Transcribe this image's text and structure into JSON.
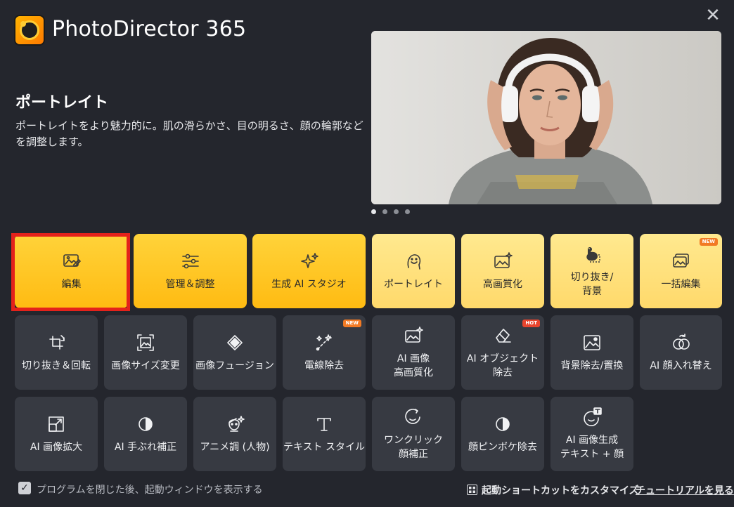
{
  "app": {
    "title": "PhotoDirector 365"
  },
  "feature": {
    "title": "ポートレイト",
    "description": "ポートレイトをより魅力的に。肌の滑らかさ、目の明るさ、顔の輪郭などを調整します。"
  },
  "carousel": {
    "count": 4,
    "active": 0
  },
  "row1": [
    {
      "label": "編集",
      "icon": "photo-edit-icon",
      "selected": true
    },
    {
      "label": "管理＆調整",
      "icon": "sliders-icon"
    },
    {
      "label": "生成 AI スタジオ",
      "icon": "sparkles-icon"
    },
    {
      "label": "ポートレイト",
      "icon": "face-icon"
    },
    {
      "label": "高画質化",
      "icon": "image-sparkle-icon"
    },
    {
      "label": "切り抜き/\n背景",
      "icon": "cutout-duck-icon"
    },
    {
      "label": "一括編集",
      "icon": "batch-images-icon",
      "badge": "NEW"
    }
  ],
  "row2": [
    {
      "label": "切り抜き＆回転",
      "icon": "crop-rotate-icon"
    },
    {
      "label": "画像サイズ変更",
      "icon": "resize-icon"
    },
    {
      "label": "画像フュージョン",
      "icon": "fusion-icon"
    },
    {
      "label": "電線除去",
      "icon": "wire-remove-icon",
      "badge": "NEW"
    },
    {
      "label": "AI 画像\n高画質化",
      "icon": "image-sparkle-icon"
    },
    {
      "label": "AI オブジェクト\n除去",
      "icon": "eraser-icon",
      "badge": "HOT"
    },
    {
      "label": "背景除去/置換",
      "icon": "background-icon"
    },
    {
      "label": "AI 顔入れ替え",
      "icon": "face-swap-icon"
    }
  ],
  "row3": [
    {
      "label": "AI 画像拡大",
      "icon": "expand-icon"
    },
    {
      "label": "AI 手ぶれ補正",
      "icon": "half-circle-icon"
    },
    {
      "label": "アニメ調 (人物)",
      "icon": "anime-face-icon"
    },
    {
      "label": "テキスト スタイル",
      "icon": "text-icon"
    },
    {
      "label": "ワンクリック\n顔補正",
      "icon": "one-click-face-icon"
    },
    {
      "label": "顔ピンボケ除去",
      "icon": "half-circle-icon"
    },
    {
      "label": "AI 画像生成\nテキスト + 顔",
      "icon": "text-face-icon"
    }
  ],
  "footer": {
    "checkbox_label": "プログラムを閉じた後、起動ウィンドウを表示する",
    "checkbox_checked": true,
    "shortcut_label": "起動ショートカットをカスタマイズ",
    "tutorial_label": "チュートリアルを見る"
  },
  "colors": {
    "background": "#24262d",
    "tile_dark": "#373a42",
    "tile_yellow": "#ffc61f",
    "tile_light_yellow": "#ffe37f",
    "selection": "#e4221b",
    "badge_new": "#f27a24",
    "badge_hot": "#e8452e"
  }
}
